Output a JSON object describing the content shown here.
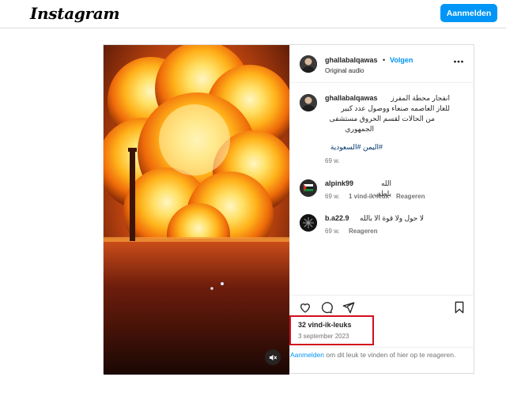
{
  "header": {
    "logo": "Instagram",
    "login_button": "Aanmelden"
  },
  "post": {
    "author": {
      "username": "ghallabalqawas",
      "separator": "•",
      "follow_label": "Volgen",
      "audio": "Original audio"
    },
    "caption": {
      "username": "ghallabalqawas",
      "lines": [
        "انفجار محطة المفرز",
        "للغاز العاصمه صنعاء ووصول عدد كبير",
        "من الحالات لقسم الحروق مستشفى",
        "الجمهوري"
      ],
      "hashtags": "#اليمن #السعودية",
      "age": "69 w."
    },
    "comments": [
      {
        "username": "alpink99",
        "text": "الله يلطف",
        "age": "69 w.",
        "likes": "1 vind-ik-leuk",
        "reply": "Reageren"
      },
      {
        "username": "b.a22.9",
        "text": "لا حول ولا قوة الا بالله",
        "age": "69 w.",
        "reply": "Reageren"
      }
    ],
    "likes_count": "32 vind-ik-leuks",
    "date": "3 september 2023",
    "login_prompt": {
      "link": "Aanmelden",
      "text": " om dit leuk te vinden of hier op te reageren."
    }
  },
  "colors": {
    "accent": "#0095f6",
    "highlight_box": "#d10f1e"
  },
  "icons": [
    "more-options-icon",
    "heart-icon",
    "comment-icon",
    "share-icon",
    "bookmark-icon",
    "mute-icon"
  ]
}
